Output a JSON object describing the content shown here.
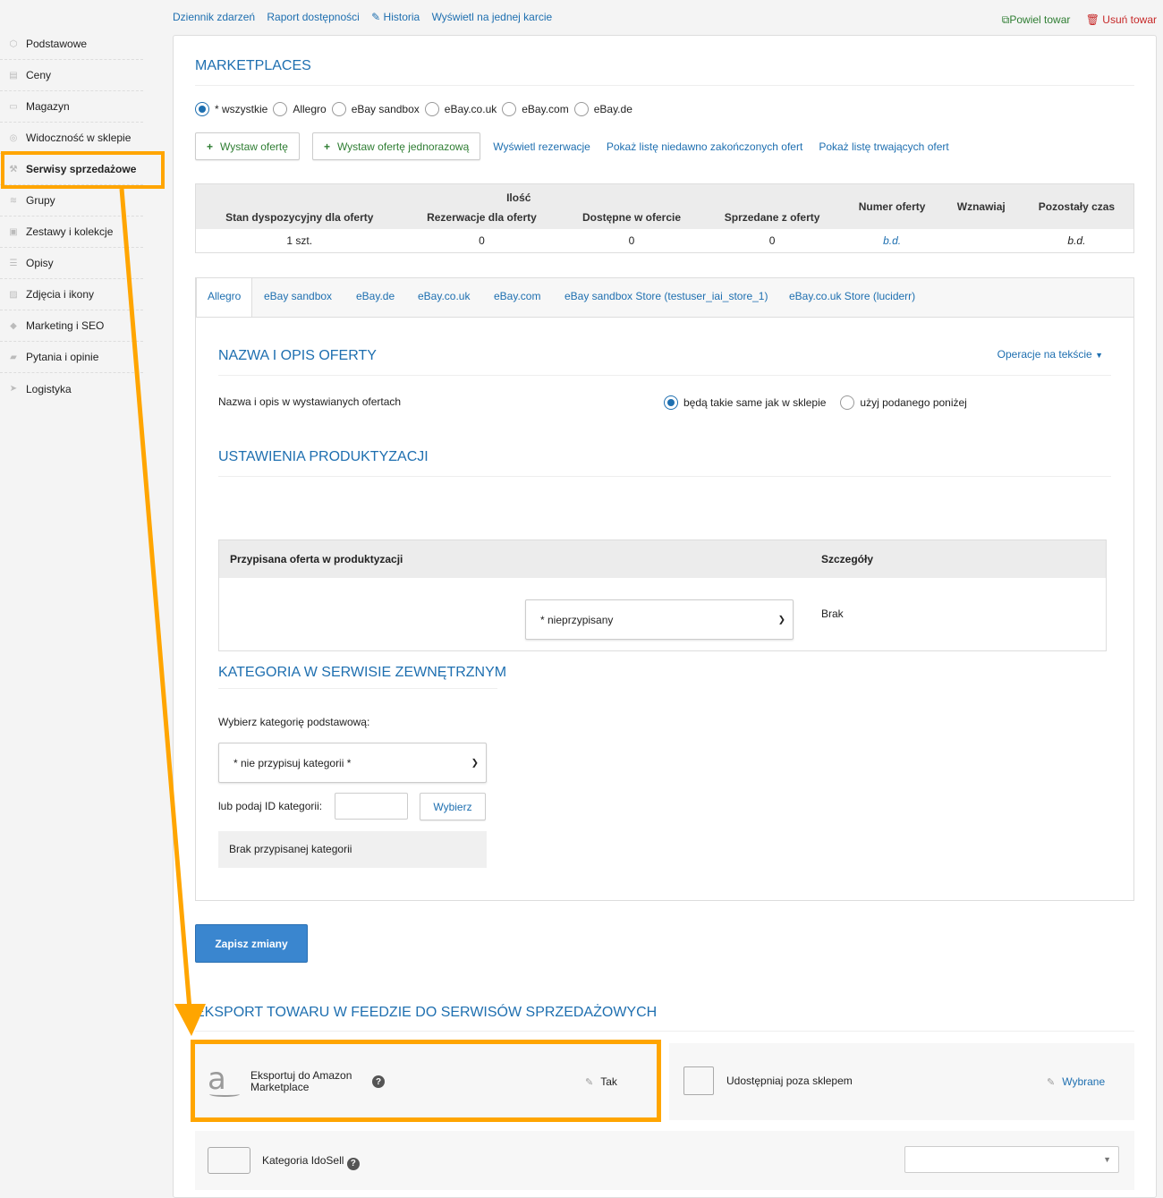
{
  "sidebar": {
    "items": [
      {
        "label": "Podstawowe",
        "icon": "cube-icon"
      },
      {
        "label": "Ceny",
        "icon": "price-icon"
      },
      {
        "label": "Magazyn",
        "icon": "warehouse-icon"
      },
      {
        "label": "Widoczność w sklepie",
        "icon": "eye-icon"
      },
      {
        "label": "Serwisy sprzedażowe",
        "icon": "gavel-icon"
      },
      {
        "label": "Grupy",
        "icon": "layers-icon"
      },
      {
        "label": "Zestawy i kolekcje",
        "icon": "set-icon"
      },
      {
        "label": "Opisy",
        "icon": "text-icon"
      },
      {
        "label": "Zdjęcia i ikony",
        "icon": "image-icon"
      },
      {
        "label": "Marketing i SEO",
        "icon": "marketing-icon"
      },
      {
        "label": "Pytania i opinie",
        "icon": "chat-icon"
      },
      {
        "label": "Logistyka",
        "icon": "send-icon"
      }
    ]
  },
  "topbar": {
    "links": [
      "Dziennik zdarzeń",
      "Raport dostępności",
      "Historia",
      "Wyświetl na jednej karcie"
    ],
    "copy_label": "Powiel towar",
    "delete_label": "Usuń towar"
  },
  "marketplaces": {
    "title": "MARKETPLACES",
    "radios": [
      "* wszystkie",
      "Allegro",
      "eBay sandbox",
      "eBay.co.uk",
      "eBay.com",
      "eBay.de"
    ],
    "selected": "* wszystkie",
    "btn_offer": "Wystaw ofertę",
    "btn_single_offer": "Wystaw ofertę jednorazową",
    "links": [
      "Wyświetl rezerwacje",
      "Pokaż listę niedawno zakończonych ofert",
      "Pokaż listę trwających ofert"
    ]
  },
  "qty_table": {
    "group_header": "Ilość",
    "headers": [
      "Stan dyspozycyjny dla oferty",
      "Rezerwacje dla oferty",
      "Dostępne w ofercie",
      "Sprzedane z oferty",
      "Numer oferty",
      "Wznawiaj",
      "Pozostały czas"
    ],
    "row": [
      "1 szt.",
      "0",
      "0",
      "0",
      "b.d.",
      "",
      "b.d."
    ]
  },
  "tabs": [
    "Allegro",
    "eBay sandbox",
    "eBay.de",
    "eBay.co.uk",
    "eBay.com",
    "eBay sandbox Store (testuser_iai_store_1)",
    "eBay.co.uk Store (luciderr)"
  ],
  "name_section": {
    "title": "NAZWA I OPIS OFERTY",
    "ops_link": "Operacje na tekście",
    "label": "Nazwa i opis w wystawianych ofertach",
    "opt_same": "będą takie same jak w sklepie",
    "opt_custom": "użyj podanego poniżej"
  },
  "productization": {
    "title": "USTAWIENIA PRODUKTYZACJI",
    "col_offer": "Przypisana oferta w produktyzacji",
    "col_details": "Szczegóły",
    "select_value": "* nieprzypisany",
    "details_value": "Brak"
  },
  "category": {
    "title": "KATEGORIA W SERWISIE ZEWNĘTRZNYM",
    "label": "Wybierz kategorię podstawową:",
    "select_value": "* nie przypisuj kategorii *",
    "id_label": "lub podaj ID kategorii:",
    "id_value": "",
    "choose_btn": "Wybierz",
    "none_msg": "Brak przypisanej kategorii"
  },
  "save_label": "Zapisz zmiany",
  "export": {
    "title": "EKSPORT TOWARU W FEEDZIE DO SERWISÓW SPRZEDAŻOWYCH",
    "amazon_label_1": "Eksportuj do Amazon",
    "amazon_label_2": "Marketplace",
    "amazon_value": "Tak",
    "share_label": "Udostępniaj poza sklepem",
    "share_value": "Wybrane",
    "idosell_label": "Kategoria IdoSell",
    "idosell_value": ""
  },
  "colors": {
    "accent": "#1e6fb0",
    "highlight": "#ffa500",
    "save": "#3a86cf",
    "green": "#2e7d32",
    "red": "#c62828"
  }
}
